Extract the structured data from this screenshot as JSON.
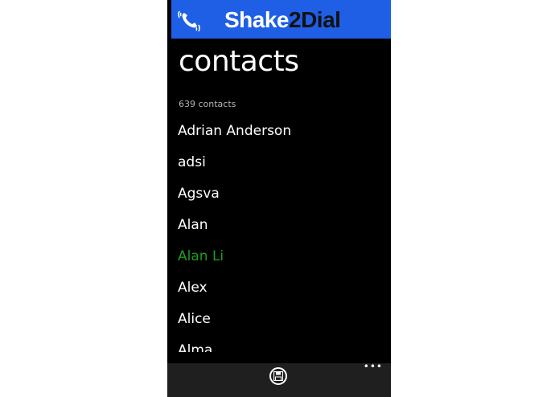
{
  "app": {
    "brand_part1": "Shake",
    "brand_part2": "2Dial",
    "brand_colors": {
      "header_bg": "#1f5fe6",
      "brand_primary": "#ffffff",
      "brand_secondary": "#111111"
    },
    "header_icon": "phone-shake-icon"
  },
  "page": {
    "title": "contacts",
    "count_text": "639 contacts"
  },
  "contacts": [
    {
      "name": "Adrian Anderson",
      "color": "#ffffff"
    },
    {
      "name": "adsi",
      "color": "#ffffff"
    },
    {
      "name": "Agsva",
      "color": "#ffffff"
    },
    {
      "name": "Alan",
      "color": "#ffffff"
    },
    {
      "name": "Alan Li",
      "color": "#1e9e1e"
    },
    {
      "name": "Alex",
      "color": "#ffffff"
    },
    {
      "name": "Alice",
      "color": "#ffffff"
    },
    {
      "name": "Alma",
      "color": "#ffffff"
    }
  ],
  "app_bar": {
    "save_icon": "floppy-save-icon",
    "more_label": "•••"
  }
}
